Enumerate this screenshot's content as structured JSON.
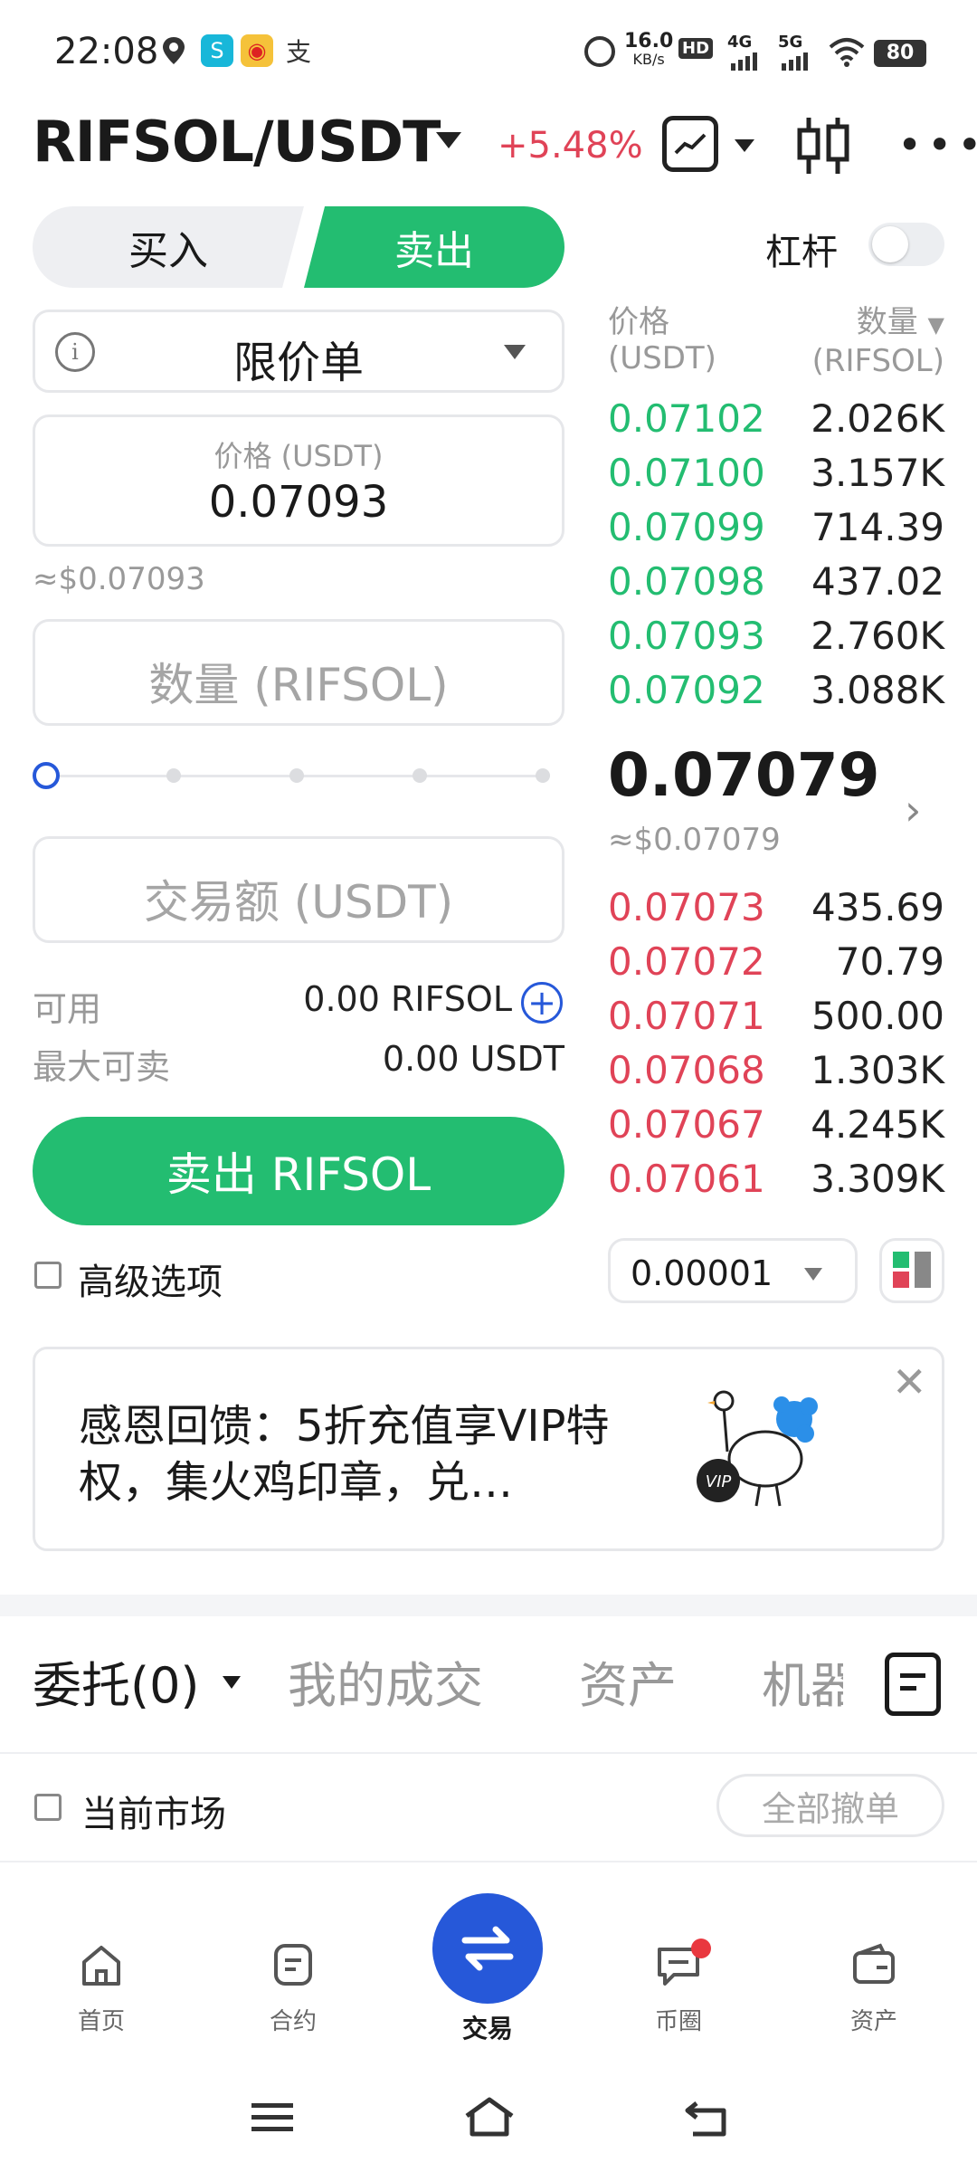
{
  "status_bar": {
    "time": "22:08",
    "net_speed": "16.0",
    "net_unit": "KB/s",
    "hd": "HD",
    "sig1": "4G",
    "sig2": "5G",
    "battery": "80"
  },
  "header": {
    "pair": "RIFSOL/USDT",
    "change": "+5.48%"
  },
  "trade_tabs": {
    "buy": "买入",
    "sell": "卖出",
    "leverage": "杠杆"
  },
  "form": {
    "order_type": "限价单",
    "price_label": "价格 (USDT)",
    "price_value": "0.07093",
    "price_approx": "≈$0.07093",
    "qty_placeholder": "数量 (RIFSOL)",
    "amount_placeholder": "交易额 (USDT)",
    "available_label": "可用",
    "available_value": "0.00 RIFSOL",
    "max_sell_label": "最大可卖",
    "max_sell_value": "0.00 USDT",
    "submit": "卖出 RIFSOL",
    "advanced": "高级选项",
    "slider_percent": 0
  },
  "orderbook": {
    "price_header": "价格",
    "price_unit": "(USDT)",
    "qty_header": "数量",
    "qty_unit": "(RIFSOL)",
    "asks": [
      {
        "price": "0.07102",
        "qty": "2.026K"
      },
      {
        "price": "0.07100",
        "qty": "3.157K"
      },
      {
        "price": "0.07099",
        "qty": "714.39"
      },
      {
        "price": "0.07098",
        "qty": "437.02"
      },
      {
        "price": "0.07093",
        "qty": "2.760K"
      },
      {
        "price": "0.07092",
        "qty": "3.088K"
      }
    ],
    "last_price": "0.07079",
    "last_approx": "≈$0.07079",
    "bids": [
      {
        "price": "0.07073",
        "qty": "435.69"
      },
      {
        "price": "0.07072",
        "qty": "70.79"
      },
      {
        "price": "0.07071",
        "qty": "500.00"
      },
      {
        "price": "0.07068",
        "qty": "1.303K"
      },
      {
        "price": "0.07067",
        "qty": "4.245K"
      },
      {
        "price": "0.07061",
        "qty": "3.309K"
      }
    ],
    "precision": "0.00001"
  },
  "banner": {
    "text": "感恩回馈：5折充值享VIP特权，集火鸡印章，兑…",
    "badge": "VIP"
  },
  "bottom_tabs": {
    "orders": "委托(0)",
    "my_trades": "我的成交",
    "assets": "资产",
    "bots": "机器"
  },
  "filters": {
    "current_market": "当前市场",
    "cancel_all": "全部撤单"
  },
  "nav": {
    "home": "首页",
    "futures": "合约",
    "trade": "交易",
    "community": "币圈",
    "assets": "资产"
  },
  "colors": {
    "green": "#23bd71",
    "red": "#e04357",
    "blue": "#2658d9"
  }
}
